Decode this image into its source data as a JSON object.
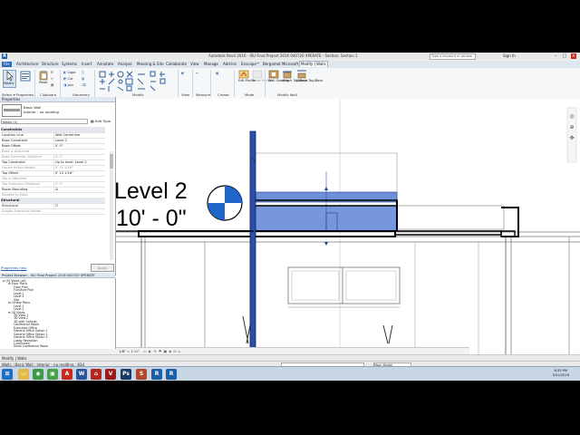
{
  "window": {
    "title": "Autodesk Revit 2016 - ISU Final Project 2016 040720 XPERATE - Section: Section 1",
    "search_placeholder": "Type a keyword or phrase",
    "user": "Sign In"
  },
  "ribbon_tabs": [
    "File",
    "Architecture",
    "Structure",
    "Systems",
    "Insert",
    "Annotate",
    "Analyze",
    "Massing & Site",
    "Collaborate",
    "View",
    "Manage",
    "Add-Ins",
    "Enscape™",
    "Bergamot Microsoft",
    "Modify | Walls"
  ],
  "ribbon": {
    "modify_label": "Modify",
    "select_label": "Select ▾",
    "properties_label": "Properties",
    "clipboard_label": "Clipboard",
    "geometry_label": "Geometry",
    "modify_panel_label": "Modify",
    "view_label": "View",
    "measure_label": "Measure",
    "create_label": "Create",
    "mode_label": "Mode",
    "modify_wall_label": "Modify Wall",
    "paste_label": "Paste",
    "cope_label": "Cope",
    "cut_label": "Cut",
    "join_label": "Join",
    "edit_profile": "Edit Profile",
    "reset_profile": "Reset Profile",
    "wall_opening": "Wall Opening",
    "attach_top_base": "Attach Top/Base",
    "detach_top_base": "Detach Top/Base"
  },
  "properties": {
    "header": "Properties",
    "type_name": "Basic Wall",
    "type_sub": "Interior - no molding",
    "instance_selector": "Walls (1)",
    "edit_type": "Edit Type",
    "section_constraints": "Constraints",
    "rows": [
      {
        "k": "Location Line",
        "v": "Wall Centerline",
        "dim": false
      },
      {
        "k": "Base Constraint",
        "v": "Level 2",
        "dim": false
      },
      {
        "k": "Base Offset",
        "v": "0'  0\"",
        "dim": false
      },
      {
        "k": "Base is Attached",
        "v": "",
        "dim": true
      },
      {
        "k": "Base Extension Distance",
        "v": "0'  0\"",
        "dim": true
      },
      {
        "k": "Top Constraint",
        "v": "Up to level: Level 2",
        "dim": false
      },
      {
        "k": "Unconnected Height",
        "v": "3'  10 1/16\"",
        "dim": true
      },
      {
        "k": "Top Offset",
        "v": "0'  10 1/16\"",
        "dim": false
      },
      {
        "k": "Top is Attached",
        "v": "",
        "dim": true
      },
      {
        "k": "Top Extension Distance",
        "v": "0'  0\"",
        "dim": true
      },
      {
        "k": "Room Bounding",
        "v": "☑",
        "dim": false
      },
      {
        "k": "Related to Mass",
        "v": "",
        "dim": true
      }
    ],
    "section_structural": "Structural",
    "structural_rows": [
      {
        "k": "Structural",
        "v": "☐",
        "dim": false
      },
      {
        "k": "Enable Analytical Model",
        "v": "",
        "dim": true
      }
    ],
    "help_link": "Properties help",
    "apply": "Apply"
  },
  "browser": {
    "header": "Project Browser - ISU Final Project 2016 040720 XPERATE",
    "items": [
      {
        "t": "⊟ [0] Views (all)",
        "d": 0
      },
      {
        "t": "⊟ Floor Plans",
        "d": 1
      },
      {
        "t": "Floor Plan",
        "d": 2
      },
      {
        "t": "Furniture Plan",
        "d": 2
      },
      {
        "t": "Level 1",
        "d": 2
      },
      {
        "t": "Level 2",
        "d": 2
      },
      {
        "t": "Site",
        "d": 2
      },
      {
        "t": "⊟ Ceiling Plans",
        "d": 1
      },
      {
        "t": "Level 1",
        "d": 2
      },
      {
        "t": "Level 2",
        "d": 2
      },
      {
        "t": "⊟ 3D Views",
        "d": 1
      },
      {
        "t": "3D View 1",
        "d": 2
      },
      {
        "t": "3D View 2",
        "d": 2
      },
      {
        "t": "3D with Ceilings",
        "d": 2
      },
      {
        "t": "Conference Room",
        "d": 2
      },
      {
        "t": "Executive Office",
        "d": 2
      },
      {
        "t": "General Office Option 1",
        "d": 2
      },
      {
        "t": "General Office Option 2",
        "d": 2
      },
      {
        "t": "General Office Option 3",
        "d": 2
      },
      {
        "t": "Lobby Reception",
        "d": 2
      },
      {
        "t": "Lunchroom",
        "d": 2
      },
      {
        "t": "Small Conference Room",
        "d": 2
      }
    ]
  },
  "canvas": {
    "level_name": "Level 2",
    "level_elev": "10' - 0\"",
    "scale": "1/8\" = 1'-0\""
  },
  "status": {
    "line1": "Modify | Walls",
    "line2": "Walls : Basic Wall : Interior - no molding : 834",
    "main_model": "Main Model"
  },
  "taskbar": {
    "time": "8:35 PM",
    "date": "5/31/2016",
    "icons": [
      {
        "name": "start-icon",
        "color": "#1d6fc4",
        "glyph": "⊞"
      },
      {
        "name": "explorer-icon",
        "color": "#e2b84a",
        "glyph": "▭"
      },
      {
        "name": "chrome-icon",
        "color": "#3c9a46",
        "glyph": "◉"
      },
      {
        "name": "app-icon",
        "color": "#48a048",
        "glyph": "▣"
      },
      {
        "name": "acrobat-icon",
        "color": "#c52a1c",
        "glyph": "A"
      },
      {
        "name": "word-icon",
        "color": "#2b579a",
        "glyph": "W"
      },
      {
        "name": "pdf-icon",
        "color": "#b3261e",
        "glyph": "⌂"
      },
      {
        "name": "vray-icon",
        "color": "#9b1b1b",
        "glyph": "V"
      },
      {
        "name": "photoshop-icon",
        "color": "#163b66",
        "glyph": "Ps"
      },
      {
        "name": "sketchup-icon",
        "color": "#b2472d",
        "glyph": "S"
      },
      {
        "name": "revit-icon",
        "color": "#1b5fa8",
        "glyph": "R"
      },
      {
        "name": "revit2-icon",
        "color": "#1b5fa8",
        "glyph": "R"
      }
    ]
  }
}
